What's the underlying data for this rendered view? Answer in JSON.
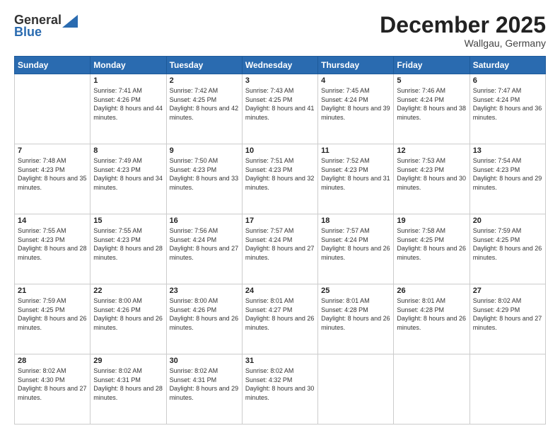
{
  "header": {
    "logo_general": "General",
    "logo_blue": "Blue",
    "month_title": "December 2025",
    "location": "Wallgau, Germany"
  },
  "days_of_week": [
    "Sunday",
    "Monday",
    "Tuesday",
    "Wednesday",
    "Thursday",
    "Friday",
    "Saturday"
  ],
  "weeks": [
    [
      {
        "day": null,
        "sunrise": null,
        "sunset": null,
        "daylight": null
      },
      {
        "day": "1",
        "sunrise": "Sunrise: 7:41 AM",
        "sunset": "Sunset: 4:26 PM",
        "daylight": "Daylight: 8 hours and 44 minutes."
      },
      {
        "day": "2",
        "sunrise": "Sunrise: 7:42 AM",
        "sunset": "Sunset: 4:25 PM",
        "daylight": "Daylight: 8 hours and 42 minutes."
      },
      {
        "day": "3",
        "sunrise": "Sunrise: 7:43 AM",
        "sunset": "Sunset: 4:25 PM",
        "daylight": "Daylight: 8 hours and 41 minutes."
      },
      {
        "day": "4",
        "sunrise": "Sunrise: 7:45 AM",
        "sunset": "Sunset: 4:24 PM",
        "daylight": "Daylight: 8 hours and 39 minutes."
      },
      {
        "day": "5",
        "sunrise": "Sunrise: 7:46 AM",
        "sunset": "Sunset: 4:24 PM",
        "daylight": "Daylight: 8 hours and 38 minutes."
      },
      {
        "day": "6",
        "sunrise": "Sunrise: 7:47 AM",
        "sunset": "Sunset: 4:24 PM",
        "daylight": "Daylight: 8 hours and 36 minutes."
      }
    ],
    [
      {
        "day": "7",
        "sunrise": "Sunrise: 7:48 AM",
        "sunset": "Sunset: 4:23 PM",
        "daylight": "Daylight: 8 hours and 35 minutes."
      },
      {
        "day": "8",
        "sunrise": "Sunrise: 7:49 AM",
        "sunset": "Sunset: 4:23 PM",
        "daylight": "Daylight: 8 hours and 34 minutes."
      },
      {
        "day": "9",
        "sunrise": "Sunrise: 7:50 AM",
        "sunset": "Sunset: 4:23 PM",
        "daylight": "Daylight: 8 hours and 33 minutes."
      },
      {
        "day": "10",
        "sunrise": "Sunrise: 7:51 AM",
        "sunset": "Sunset: 4:23 PM",
        "daylight": "Daylight: 8 hours and 32 minutes."
      },
      {
        "day": "11",
        "sunrise": "Sunrise: 7:52 AM",
        "sunset": "Sunset: 4:23 PM",
        "daylight": "Daylight: 8 hours and 31 minutes."
      },
      {
        "day": "12",
        "sunrise": "Sunrise: 7:53 AM",
        "sunset": "Sunset: 4:23 PM",
        "daylight": "Daylight: 8 hours and 30 minutes."
      },
      {
        "day": "13",
        "sunrise": "Sunrise: 7:54 AM",
        "sunset": "Sunset: 4:23 PM",
        "daylight": "Daylight: 8 hours and 29 minutes."
      }
    ],
    [
      {
        "day": "14",
        "sunrise": "Sunrise: 7:55 AM",
        "sunset": "Sunset: 4:23 PM",
        "daylight": "Daylight: 8 hours and 28 minutes."
      },
      {
        "day": "15",
        "sunrise": "Sunrise: 7:55 AM",
        "sunset": "Sunset: 4:23 PM",
        "daylight": "Daylight: 8 hours and 28 minutes."
      },
      {
        "day": "16",
        "sunrise": "Sunrise: 7:56 AM",
        "sunset": "Sunset: 4:24 PM",
        "daylight": "Daylight: 8 hours and 27 minutes."
      },
      {
        "day": "17",
        "sunrise": "Sunrise: 7:57 AM",
        "sunset": "Sunset: 4:24 PM",
        "daylight": "Daylight: 8 hours and 27 minutes."
      },
      {
        "day": "18",
        "sunrise": "Sunrise: 7:57 AM",
        "sunset": "Sunset: 4:24 PM",
        "daylight": "Daylight: 8 hours and 26 minutes."
      },
      {
        "day": "19",
        "sunrise": "Sunrise: 7:58 AM",
        "sunset": "Sunset: 4:25 PM",
        "daylight": "Daylight: 8 hours and 26 minutes."
      },
      {
        "day": "20",
        "sunrise": "Sunrise: 7:59 AM",
        "sunset": "Sunset: 4:25 PM",
        "daylight": "Daylight: 8 hours and 26 minutes."
      }
    ],
    [
      {
        "day": "21",
        "sunrise": "Sunrise: 7:59 AM",
        "sunset": "Sunset: 4:25 PM",
        "daylight": "Daylight: 8 hours and 26 minutes."
      },
      {
        "day": "22",
        "sunrise": "Sunrise: 8:00 AM",
        "sunset": "Sunset: 4:26 PM",
        "daylight": "Daylight: 8 hours and 26 minutes."
      },
      {
        "day": "23",
        "sunrise": "Sunrise: 8:00 AM",
        "sunset": "Sunset: 4:26 PM",
        "daylight": "Daylight: 8 hours and 26 minutes."
      },
      {
        "day": "24",
        "sunrise": "Sunrise: 8:01 AM",
        "sunset": "Sunset: 4:27 PM",
        "daylight": "Daylight: 8 hours and 26 minutes."
      },
      {
        "day": "25",
        "sunrise": "Sunrise: 8:01 AM",
        "sunset": "Sunset: 4:28 PM",
        "daylight": "Daylight: 8 hours and 26 minutes."
      },
      {
        "day": "26",
        "sunrise": "Sunrise: 8:01 AM",
        "sunset": "Sunset: 4:28 PM",
        "daylight": "Daylight: 8 hours and 26 minutes."
      },
      {
        "day": "27",
        "sunrise": "Sunrise: 8:02 AM",
        "sunset": "Sunset: 4:29 PM",
        "daylight": "Daylight: 8 hours and 27 minutes."
      }
    ],
    [
      {
        "day": "28",
        "sunrise": "Sunrise: 8:02 AM",
        "sunset": "Sunset: 4:30 PM",
        "daylight": "Daylight: 8 hours and 27 minutes."
      },
      {
        "day": "29",
        "sunrise": "Sunrise: 8:02 AM",
        "sunset": "Sunset: 4:31 PM",
        "daylight": "Daylight: 8 hours and 28 minutes."
      },
      {
        "day": "30",
        "sunrise": "Sunrise: 8:02 AM",
        "sunset": "Sunset: 4:31 PM",
        "daylight": "Daylight: 8 hours and 29 minutes."
      },
      {
        "day": "31",
        "sunrise": "Sunrise: 8:02 AM",
        "sunset": "Sunset: 4:32 PM",
        "daylight": "Daylight: 8 hours and 30 minutes."
      },
      {
        "day": null,
        "sunrise": null,
        "sunset": null,
        "daylight": null
      },
      {
        "day": null,
        "sunrise": null,
        "sunset": null,
        "daylight": null
      },
      {
        "day": null,
        "sunrise": null,
        "sunset": null,
        "daylight": null
      }
    ]
  ]
}
